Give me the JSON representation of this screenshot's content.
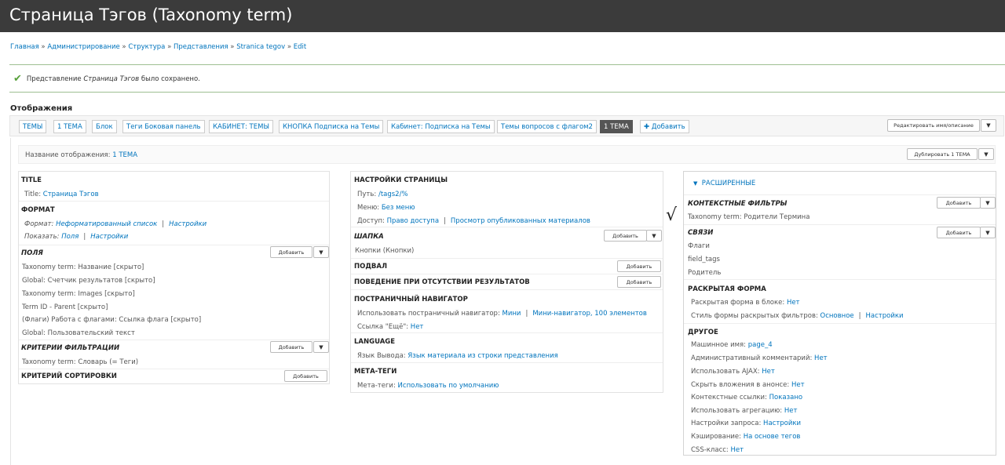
{
  "header": {
    "title": "Страница Тэгов (Taxonomy term)"
  },
  "breadcrumb": [
    "Главная",
    "Администрирование",
    "Структура",
    "Представления",
    "Stranica tegov",
    "Edit"
  ],
  "status": {
    "prefix": "Представление ",
    "name": "Страница Тэгов",
    "suffix": " было сохранено."
  },
  "displays": {
    "title": "Отображения",
    "tabs": [
      "ТЕМЫ",
      "1 ТЕМА",
      "Блок",
      "Теги Боковая панель",
      "КАБИНЕТ: ТЕМЫ",
      "КНОПКА Подписка на Темы",
      "Кабинет: Подписка на Темы",
      "Темы вопросов с флагом2",
      "1 ТЕМА"
    ],
    "add_label": "Добавить",
    "edit_name_label": "Редактировать имя/описание"
  },
  "display_name": {
    "label": "Название отображения:",
    "value": "1 ТЕМА",
    "duplicate_label": "Дублировать 1 ТЕМА"
  },
  "col1": {
    "title_head": "TITLE",
    "title_label": "Title:",
    "title_value": "Страница Тэгов",
    "format_head": "ФОРМАТ",
    "format_label": "Формат:",
    "format_value": "Неформатированный список",
    "format_settings": "Настройки",
    "show_label": "Показать:",
    "show_value": "Поля",
    "show_settings": "Настройки",
    "fields_head": "ПОЛЯ",
    "fields": [
      "Taxonomy term: Название [скрыто]",
      "Global: Счетчик результатов [скрыто]",
      "Taxonomy term: Images [скрыто]",
      "Term ID - Parent [скрыто]",
      "(Флаги) Работа с флагами: Ссылка флага [скрыто]",
      "Global: Пользовательский текст"
    ],
    "filters_head": "КРИТЕРИИ ФИЛЬТРАЦИИ",
    "filters": [
      "Taxonomy term: Словарь (= Теги)"
    ],
    "sort_head": "КРИТЕРИЙ СОРТИРОВКИ",
    "add": "Добавить"
  },
  "col2": {
    "page_head": "НАСТРОЙКИ СТРАНИЦЫ",
    "path_label": "Путь:",
    "path_value": "/tags2/%",
    "menu_label": "Меню:",
    "menu_value": "Без меню",
    "access_label": "Доступ:",
    "access_value": "Право доступа",
    "access_value2": "Просмотр опубликованных материалов",
    "header_head": "ШАПКА",
    "header_items": [
      "Кнопки (Кнопки)"
    ],
    "footer_head": "ПОДВАЛ",
    "empty_head": "ПОВЕДЕНИЕ ПРИ ОТСУТСТВИИ РЕЗУЛЬТАТОВ",
    "pager_head": "ПОСТРАНИЧНЫЙ НАВИГАТОР",
    "pager_label": "Использовать постраничный навигатор:",
    "pager_value": "Мини",
    "pager_value2": "Мини-навигатор, 100 элементов",
    "more_label": "Ссылка \"Ещё\":",
    "more_value": "Нет",
    "lang_head": "LANGUAGE",
    "lang_label": "Язык Вывода:",
    "lang_value": "Язык материала из строки представления",
    "meta_head": "МЕТА-ТЕГИ",
    "meta_label": "Мета-теги:",
    "meta_value": "Использовать по умолчанию",
    "add": "Добавить"
  },
  "col3": {
    "adv_head": "РАСШИРЕННЫЕ",
    "ctx_head": "КОНТЕКСТНЫЕ ФИЛЬТРЫ",
    "ctx_items": [
      "Taxonomy term: Родители Термина"
    ],
    "rel_head": "СВЯЗИ",
    "rel_items": [
      "Флаги",
      "field_tags",
      "Родитель"
    ],
    "exp_head": "РАСКРЫТАЯ ФОРМА",
    "exp_block_label": "Раскрытая форма в блоке:",
    "exp_block_value": "Нет",
    "exp_style_label": "Стиль формы раскрытых фильтров:",
    "exp_style_value": "Основное",
    "exp_style_settings": "Настройки",
    "other_head": "ДРУГОЕ",
    "other": [
      {
        "label": "Машинное имя:",
        "value": "page_4"
      },
      {
        "label": "Административный комментарий:",
        "value": "Нет"
      },
      {
        "label": "Использовать AJAX:",
        "value": "Нет"
      },
      {
        "label": "Скрыть вложения в анонсе:",
        "value": "Нет"
      },
      {
        "label": "Контекстные ссылки:",
        "value": "Показано"
      },
      {
        "label": "Использовать агрегацию:",
        "value": "Нет"
      },
      {
        "label": "Настройки запроса:",
        "value": "Настройки"
      },
      {
        "label": "Кэширование:",
        "value": "На основе тегов"
      },
      {
        "label": "CSS-класс:",
        "value": "Нет"
      }
    ],
    "add": "Добавить"
  },
  "annotation": {
    "mark": "√"
  }
}
